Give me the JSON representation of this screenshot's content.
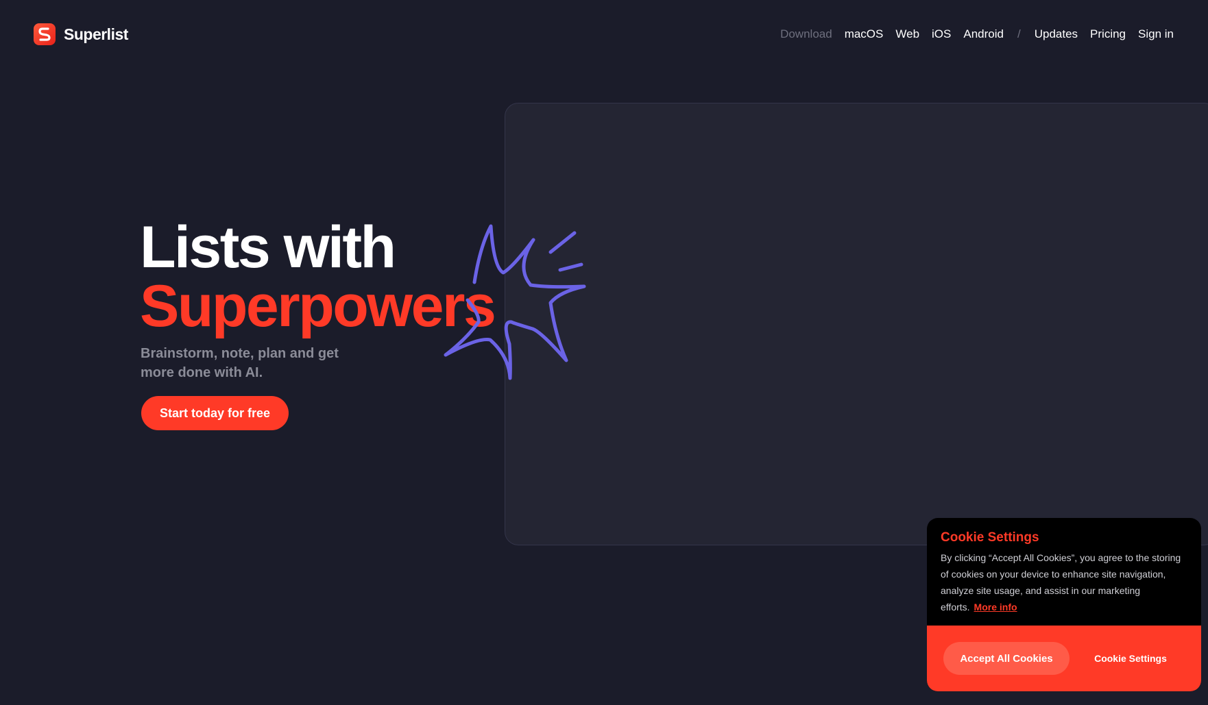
{
  "brand": {
    "name": "Superlist",
    "logo_icon": "superlist-s-logo-icon",
    "accent": "#ff3a27"
  },
  "nav": {
    "download": "Download",
    "items": [
      "macOS",
      "Web",
      "iOS",
      "Android"
    ],
    "separator": "/",
    "updates": "Updates",
    "pricing": "Pricing",
    "sign_in": "Sign in"
  },
  "hero": {
    "title_line1": "Lists with",
    "title_line2": "Superpowers",
    "subtitle": "Brainstorm, note, plan and get more done with AI.",
    "cta": "Start today for free",
    "decoration_icon": "sparkle-doodle-icon",
    "decoration_color": "#6b63e6"
  },
  "cookie": {
    "title": "Cookie Settings",
    "text": "By clicking “Accept All Cookies”, you agree to the storing of cookies on your device to enhance site navigation, analyze site usage, and assist in our marketing efforts.",
    "more_info": "More info",
    "accept_label": "Accept All Cookies",
    "settings_label": "Cookie Settings"
  }
}
